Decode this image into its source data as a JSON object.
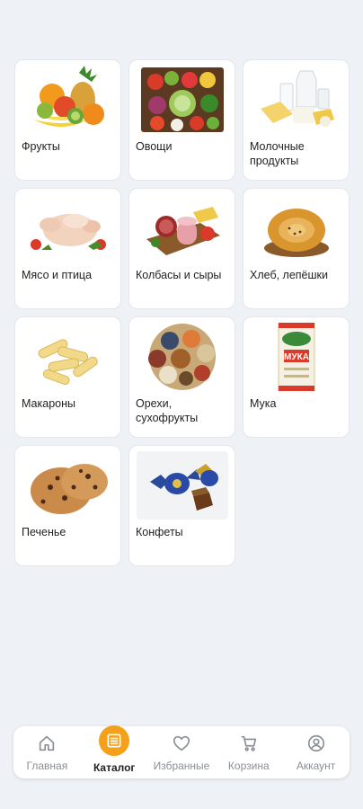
{
  "categories": [
    {
      "label": "Фрукты",
      "icon": "fruits-image"
    },
    {
      "label": "Овощи",
      "icon": "vegetables-image"
    },
    {
      "label": "Молочные продукты",
      "icon": "dairy-image"
    },
    {
      "label": "Мясо и птица",
      "icon": "meat-poultry-image"
    },
    {
      "label": "Колбасы и сыры",
      "icon": "sausage-cheese-image"
    },
    {
      "label": "Хлеб, лепёшки",
      "icon": "bread-image"
    },
    {
      "label": "Макароны",
      "icon": "pasta-image"
    },
    {
      "label": "Орехи, сухофрукты",
      "icon": "nuts-image"
    },
    {
      "label": "Мука",
      "icon": "flour-image",
      "package_text": "МУКА"
    },
    {
      "label": "Печенье",
      "icon": "cookies-image"
    },
    {
      "label": "Конфеты",
      "icon": "candy-image"
    }
  ],
  "nav": {
    "items": [
      {
        "label": "Главная",
        "icon": "home-icon"
      },
      {
        "label": "Каталог",
        "icon": "catalog-icon",
        "active": true
      },
      {
        "label": "Избранные",
        "icon": "heart-icon"
      },
      {
        "label": "Корзина",
        "icon": "cart-icon"
      },
      {
        "label": "Аккаунт",
        "icon": "account-icon"
      }
    ]
  },
  "colors": {
    "accent": "#f5a019",
    "background": "#eef1f5"
  }
}
